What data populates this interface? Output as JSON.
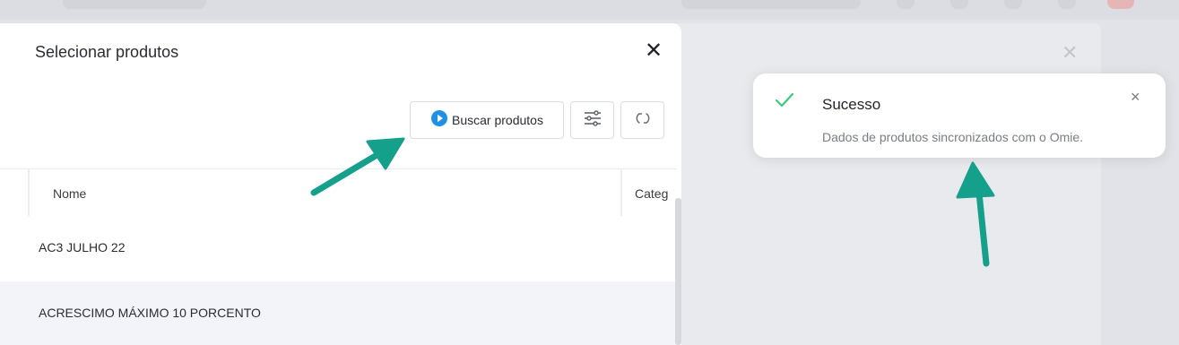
{
  "modal": {
    "title": "Selecionar produtos",
    "close_glyph": "✕",
    "toolbar": {
      "search_button_label": "Buscar produtos",
      "search_icon": "play-circle-icon",
      "filter_icon": "sliders-icon",
      "refresh_icon": "refresh-icon"
    },
    "table": {
      "columns": [
        "Nome",
        "Categ"
      ],
      "rows": [
        {
          "nome": "AC3 JULHO 22"
        },
        {
          "nome": "ACRESCIMO MÁXIMO 10 PORCENTO"
        }
      ]
    }
  },
  "toast": {
    "title": "Sucesso",
    "message": "Dados de produtos sincronizados com o Omie.",
    "close_glyph": "×",
    "icon": "check-icon"
  },
  "background": {
    "close_glyph": "✕"
  },
  "colors": {
    "accent_blue": "#1e90e6",
    "success_green": "#3ec97a",
    "annotation_arrow": "#14a08a"
  }
}
